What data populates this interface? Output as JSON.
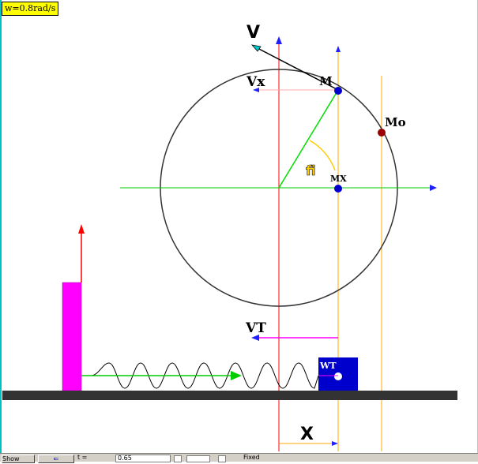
{
  "omega_label": "w=0.8rad/s",
  "labels": {
    "V": "V",
    "Vx": "Vx",
    "M": "M",
    "M0": "Mo",
    "fi": "fi",
    "MX": "MX",
    "VT": "VT",
    "WT": "WT",
    "X": "X"
  },
  "colors": {
    "circle": "#000000",
    "x_axis": "#00cc00",
    "y_axis": "#ff0000",
    "guide_lines": "#ffaa00",
    "radius": "#00dd00",
    "angle_arc": "#ffcc00",
    "velocity_vector": "#000000",
    "vx_vector": "#ffaaaa",
    "vt_vector": "#ff00ff",
    "wall": "#ff00ff",
    "block": "#0000cc",
    "ground": "#333333",
    "point_M": "#0000cc",
    "point_M0": "#990000",
    "point_MX": "#0000cc"
  },
  "bottom_bar": {
    "button1": "Show",
    "button2_icon": "back-arrow-icon",
    "text1": "t =",
    "input_value": "0.65",
    "text2": "Fixed"
  }
}
